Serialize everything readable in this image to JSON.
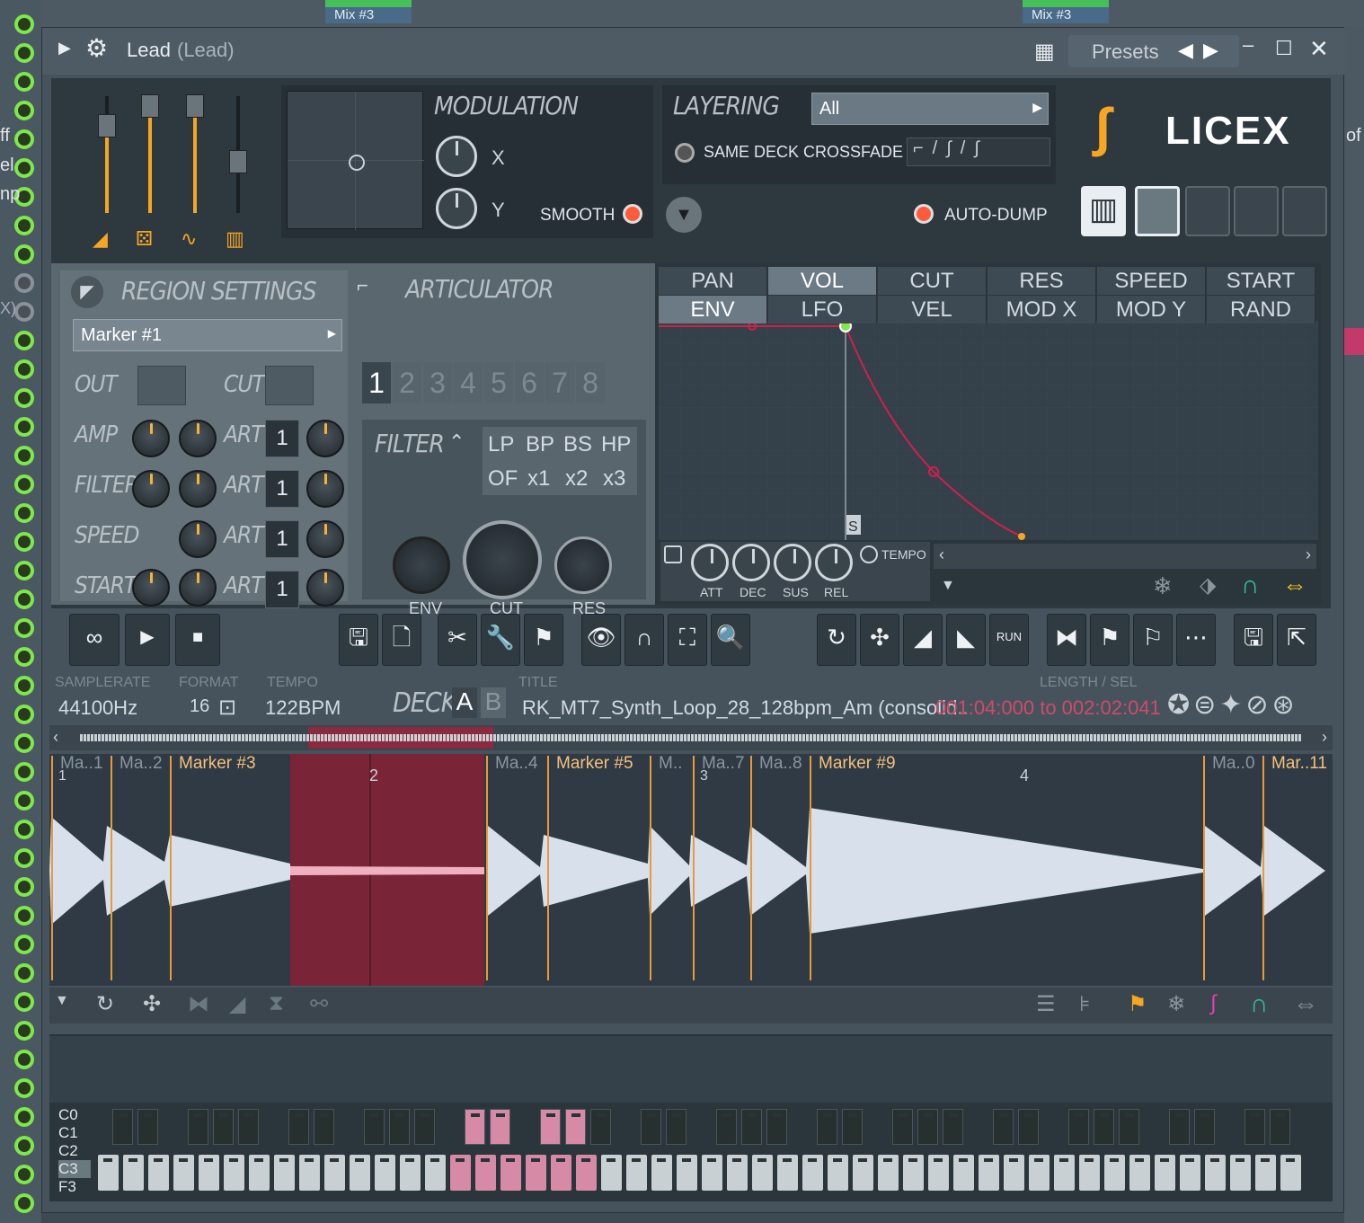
{
  "window": {
    "title": "Lead",
    "subtitle": "(Lead)",
    "presets_label": "Presets"
  },
  "side": {
    "labels": [
      "ff",
      "el",
      "np",
      "X)"
    ],
    "right_labels": [
      "of"
    ]
  },
  "topclips": [
    {
      "label": "Mix #3"
    },
    {
      "label": "Mix #3"
    }
  ],
  "modulation": {
    "title": "MODULATION",
    "x_label": "X",
    "y_label": "Y",
    "smooth_label": "SMOOTH"
  },
  "layering": {
    "title": "LAYERING",
    "selector_value": "All",
    "crossfade_label": "SAME DECK CROSSFADE",
    "autodump_label": "AUTO-DUMP"
  },
  "brand": {
    "logo_text": "LICEX"
  },
  "region": {
    "title": "REGION SETTINGS",
    "marker_value": "Marker #1",
    "out_label": "OUT",
    "cut_label": "CUT",
    "rows": [
      {
        "label": "AMP",
        "art": "ART",
        "num": "1"
      },
      {
        "label": "FILTER",
        "art": "ART",
        "num": "1"
      },
      {
        "label": "SPEED",
        "art": "ART",
        "num": "1"
      },
      {
        "label": "START",
        "art": "ART",
        "num": "1"
      }
    ]
  },
  "articulator": {
    "title": "ARTICULATOR",
    "numbers": [
      "1",
      "2",
      "3",
      "4",
      "5",
      "6",
      "7",
      "8"
    ],
    "selected": "1"
  },
  "filter": {
    "title": "FILTER",
    "types_row1": [
      "LP",
      "BP",
      "BS",
      "HP"
    ],
    "types_row2": [
      "OF",
      "x1",
      "x2",
      "x3"
    ],
    "knobs": [
      "ENV",
      "CUT",
      "RES"
    ]
  },
  "env": {
    "tabs_row1": [
      "PAN",
      "VOL",
      "CUT",
      "RES",
      "SPEED",
      "START"
    ],
    "tabs_row2": [
      "ENV",
      "LFO",
      "VEL",
      "MOD X",
      "MOD Y",
      "RAND"
    ],
    "selected_row1": "VOL",
    "selected_row2": "ENV",
    "sustain_marker": "S",
    "knobs": [
      "ATT",
      "DEC",
      "SUS",
      "REL"
    ],
    "tempo_label": "TEMPO"
  },
  "sample": {
    "samplerate_label": "SAMPLERATE",
    "samplerate": "44100Hz",
    "format_label": "FORMAT",
    "format": "16",
    "tempo_label": "TEMPO",
    "tempo": "122BPM",
    "title_label": "TITLE",
    "title": "RK_MT7_Synth_Loop_28_128bpm_Am (consolid..",
    "length_label": "LENGTH / SEL",
    "length": "001:04:000 to 002:02:041",
    "deck_label": "DECK",
    "deck_a": "A",
    "deck_b": "B"
  },
  "markers": [
    {
      "label": "Ma..1",
      "bar": "1"
    },
    {
      "label": "Ma..2"
    },
    {
      "label": "Marker #3"
    },
    {
      "label": "2"
    },
    {
      "label": "Ma..4"
    },
    {
      "label": "Marker #5"
    },
    {
      "label": "M.."
    },
    {
      "label": "Ma..7",
      "bar": "3"
    },
    {
      "label": "Ma..8"
    },
    {
      "label": "Marker #9"
    },
    {
      "label": "4"
    },
    {
      "label": "Ma..0"
    },
    {
      "label": "Mar..11"
    }
  ],
  "piano": {
    "labels": [
      "C0",
      "C1",
      "C2",
      "C3",
      "F3"
    ]
  },
  "colors": {
    "accent": "#f5a623",
    "led": "#7ee84a",
    "selection": "#8b2a3e",
    "envline": "#d0204a",
    "magenta": "#e83cb4",
    "teal": "#2ec7a6"
  }
}
